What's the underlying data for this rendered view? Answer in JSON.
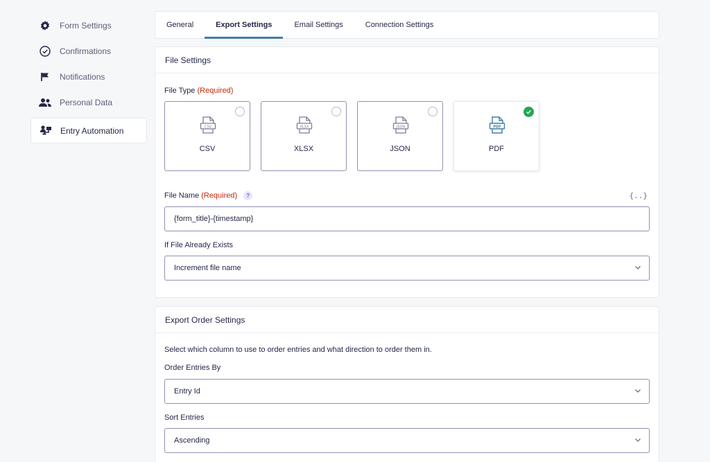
{
  "sidebar": {
    "items": [
      {
        "label": "Form Settings",
        "icon": "gear-icon"
      },
      {
        "label": "Confirmations",
        "icon": "check-circle-icon"
      },
      {
        "label": "Notifications",
        "icon": "flag-icon"
      },
      {
        "label": "Personal Data",
        "icon": "users-icon"
      },
      {
        "label": "Entry Automation",
        "icon": "automation-icon",
        "active": true
      }
    ]
  },
  "tabs": [
    {
      "label": "General"
    },
    {
      "label": "Export Settings",
      "active": true
    },
    {
      "label": "Email Settings"
    },
    {
      "label": "Connection Settings"
    }
  ],
  "file_settings": {
    "title": "File Settings",
    "file_type_label": "File Type",
    "required_text": "(Required)",
    "file_types": [
      {
        "name": "CSV",
        "badge": "CSV",
        "selected": false
      },
      {
        "name": "XLSX",
        "badge": "XLSX",
        "selected": false
      },
      {
        "name": "JSON",
        "badge": "JSON",
        "selected": false
      },
      {
        "name": "PDF",
        "badge": "PDF",
        "selected": true
      }
    ],
    "file_name_label": "File Name",
    "help_glyph": "?",
    "merge_tag_glyph": "{..}",
    "file_name_value": "{form_title}-{timestamp}",
    "exists_label": "If File Already Exists",
    "exists_value": "Increment file name"
  },
  "export_order": {
    "title": "Export Order Settings",
    "description": "Select which column to use to order entries and what direction to order them in.",
    "order_by_label": "Order Entries By",
    "order_by_value": "Entry Id",
    "sort_label": "Sort Entries",
    "sort_value": "Ascending"
  },
  "colors": {
    "accent": "#3e7da6",
    "required": "#c02b0a",
    "check": "#22a754",
    "pdf_icon": "#3e7da6"
  }
}
